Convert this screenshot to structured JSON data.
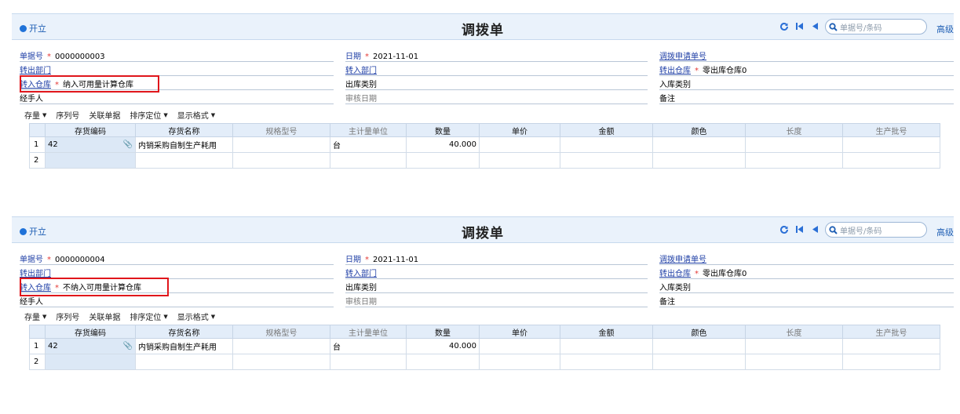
{
  "forms": [
    {
      "open_label": "开立",
      "title": "调拨单",
      "search_placeholder": "单据号/条码",
      "advanced_label": "高级",
      "fields": {
        "doc_no_label": "单据号",
        "doc_no_value": "0000000003",
        "date_label": "日期",
        "date_value": "2021-11-01",
        "request_no_label": "调拨申请单号",
        "out_dept_label": "转出部门",
        "in_dept_label": "转入部门",
        "out_wh_label": "转出仓库",
        "out_wh_value": "零出库仓库0",
        "in_wh_label": "转入仓库",
        "in_wh_value": "纳入可用量计算仓库",
        "out_type_label": "出库类别",
        "in_type_label": "入库类别",
        "handler_label": "经手人",
        "audit_date_label": "审核日期",
        "remark_label": "备注"
      },
      "toolbar": [
        "存量",
        "序列号",
        "关联单据",
        "排序定位",
        "显示格式"
      ],
      "columns": [
        "存货编码",
        "存货名称",
        "规格型号",
        "主计量单位",
        "数量",
        "单价",
        "金额",
        "颜色",
        "长度",
        "生产批号"
      ],
      "rows": [
        {
          "num": "1",
          "code": "42",
          "name": "内销采购自制生产耗用",
          "spec": "",
          "unit": "台",
          "qty": "40.000",
          "price": "",
          "amount": "",
          "color": "",
          "length": "",
          "batch": ""
        },
        {
          "num": "2",
          "code": "",
          "name": "",
          "spec": "",
          "unit": "",
          "qty": "",
          "price": "",
          "amount": "",
          "color": "",
          "length": "",
          "batch": ""
        }
      ]
    },
    {
      "open_label": "开立",
      "title": "调拨单",
      "search_placeholder": "单据号/条码",
      "advanced_label": "高级",
      "fields": {
        "doc_no_label": "单据号",
        "doc_no_value": "0000000004",
        "date_label": "日期",
        "date_value": "2021-11-01",
        "request_no_label": "调拨申请单号",
        "out_dept_label": "转出部门",
        "in_dept_label": "转入部门",
        "out_wh_label": "转出仓库",
        "out_wh_value": "零出库仓库0",
        "in_wh_label": "转入仓库",
        "in_wh_value": "不纳入可用量计算仓库",
        "out_type_label": "出库类别",
        "in_type_label": "入库类别",
        "handler_label": "经手人",
        "audit_date_label": "审核日期",
        "remark_label": "备注"
      },
      "toolbar": [
        "存量",
        "序列号",
        "关联单据",
        "排序定位",
        "显示格式"
      ],
      "columns": [
        "存货编码",
        "存货名称",
        "规格型号",
        "主计量单位",
        "数量",
        "单价",
        "金额",
        "颜色",
        "长度",
        "生产批号"
      ],
      "rows": [
        {
          "num": "1",
          "code": "42",
          "name": "内销采购自制生产耗用",
          "spec": "",
          "unit": "台",
          "qty": "40.000",
          "price": "",
          "amount": "",
          "color": "",
          "length": "",
          "batch": ""
        },
        {
          "num": "2",
          "code": "",
          "name": "",
          "spec": "",
          "unit": "",
          "qty": "",
          "price": "",
          "amount": "",
          "color": "",
          "length": "",
          "batch": ""
        }
      ]
    }
  ],
  "colors": {
    "accent": "#1f5fb4",
    "header_bg": "#eaf2fb",
    "required": "#e53935",
    "highlight_box": "#e0161b",
    "grid_header": "#e3edf9"
  }
}
